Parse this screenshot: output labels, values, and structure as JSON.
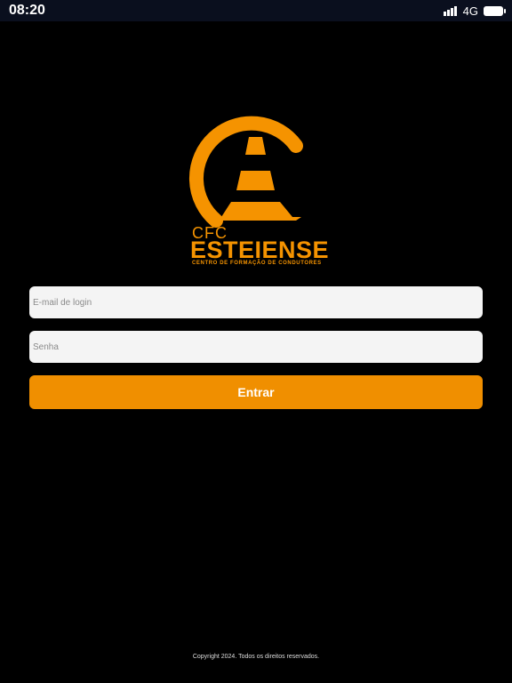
{
  "status_bar": {
    "time": "08:20",
    "network": "4G",
    "icons": [
      "signal-icon",
      "battery-icon"
    ]
  },
  "logo": {
    "line1": "CFC",
    "line2": "ESTEIENSE",
    "line3": "CENTRO DE FORMAÇÃO DE CONDUTORES",
    "color": "#f59300"
  },
  "form": {
    "email_placeholder": "E-mail de login",
    "email_value": "",
    "password_placeholder": "Senha",
    "password_value": "",
    "submit_label": "Entrar"
  },
  "footer": {
    "copyright": "Copyright 2024. Todos os direitos reservados."
  },
  "colors": {
    "accent": "#f08f00",
    "background": "#000000",
    "input_bg": "#f4f4f4"
  }
}
